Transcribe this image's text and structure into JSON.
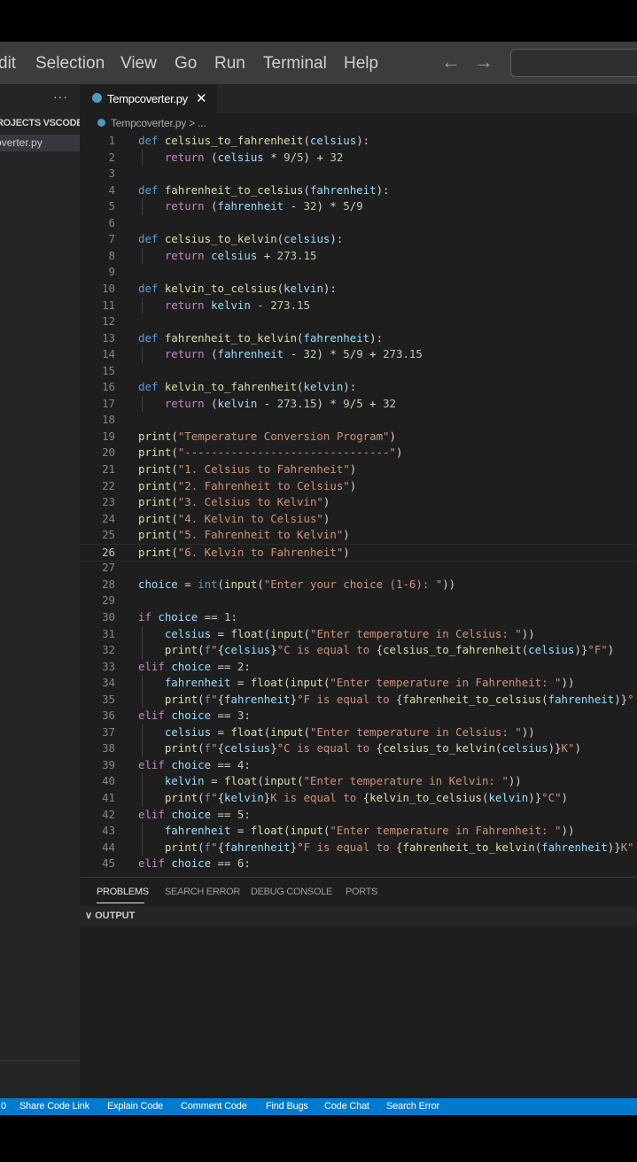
{
  "menubar": {
    "items": [
      "dit",
      "Selection",
      "View",
      "Go",
      "Run",
      "Terminal",
      "Help"
    ],
    "back_arrow": "←",
    "forward_arrow": "→"
  },
  "sidebar": {
    "more": "···",
    "section_title": "ROJECTS VSCODE",
    "file_name": "overter.py"
  },
  "editor": {
    "tab_label": "Tempcoverter.py",
    "tab_close": "✕",
    "breadcrumb": "Tempcoverter.py > ...",
    "current_line": 26,
    "lines": [
      [
        [
          "kw",
          "def "
        ],
        [
          "fn",
          "celsius_to_fahrenheit"
        ],
        [
          "pl",
          "("
        ],
        [
          "var",
          "celsius"
        ],
        [
          "pl",
          "):"
        ]
      ],
      [
        [
          "pl",
          "    "
        ],
        [
          "ctl",
          "return "
        ],
        [
          "pl",
          "("
        ],
        [
          "var",
          "celsius"
        ],
        [
          "pl",
          " * "
        ],
        [
          "num",
          "9"
        ],
        [
          "pl",
          "/"
        ],
        [
          "num",
          "5"
        ],
        [
          "pl",
          ") + "
        ],
        [
          "num",
          "32"
        ]
      ],
      [],
      [
        [
          "kw",
          "def "
        ],
        [
          "fn",
          "fahrenheit_to_celsius"
        ],
        [
          "pl",
          "("
        ],
        [
          "var",
          "fahrenheit"
        ],
        [
          "pl",
          "):"
        ]
      ],
      [
        [
          "pl",
          "    "
        ],
        [
          "ctl",
          "return "
        ],
        [
          "pl",
          "("
        ],
        [
          "var",
          "fahrenheit"
        ],
        [
          "pl",
          " - "
        ],
        [
          "num",
          "32"
        ],
        [
          "pl",
          ") * "
        ],
        [
          "num",
          "5"
        ],
        [
          "pl",
          "/"
        ],
        [
          "num",
          "9"
        ]
      ],
      [],
      [
        [
          "kw",
          "def "
        ],
        [
          "fn",
          "celsius_to_kelvin"
        ],
        [
          "pl",
          "("
        ],
        [
          "var",
          "celsius"
        ],
        [
          "pl",
          "):"
        ]
      ],
      [
        [
          "pl",
          "    "
        ],
        [
          "ctl",
          "return "
        ],
        [
          "var",
          "celsius"
        ],
        [
          "pl",
          " + "
        ],
        [
          "num",
          "273.15"
        ]
      ],
      [],
      [
        [
          "kw",
          "def "
        ],
        [
          "fn",
          "kelvin_to_celsius"
        ],
        [
          "pl",
          "("
        ],
        [
          "var",
          "kelvin"
        ],
        [
          "pl",
          "):"
        ]
      ],
      [
        [
          "pl",
          "    "
        ],
        [
          "ctl",
          "return "
        ],
        [
          "var",
          "kelvin"
        ],
        [
          "pl",
          " - "
        ],
        [
          "num",
          "273.15"
        ]
      ],
      [],
      [
        [
          "kw",
          "def "
        ],
        [
          "fn",
          "fahrenheit_to_kelvin"
        ],
        [
          "pl",
          "("
        ],
        [
          "var",
          "fahrenheit"
        ],
        [
          "pl",
          "):"
        ]
      ],
      [
        [
          "pl",
          "    "
        ],
        [
          "ctl",
          "return "
        ],
        [
          "pl",
          "("
        ],
        [
          "var",
          "fahrenheit"
        ],
        [
          "pl",
          " - "
        ],
        [
          "num",
          "32"
        ],
        [
          "pl",
          ") * "
        ],
        [
          "num",
          "5"
        ],
        [
          "pl",
          "/"
        ],
        [
          "num",
          "9"
        ],
        [
          "pl",
          " + "
        ],
        [
          "num",
          "273.15"
        ]
      ],
      [],
      [
        [
          "kw",
          "def "
        ],
        [
          "fn",
          "kelvin_to_fahrenheit"
        ],
        [
          "pl",
          "("
        ],
        [
          "var",
          "kelvin"
        ],
        [
          "pl",
          "):"
        ]
      ],
      [
        [
          "pl",
          "    "
        ],
        [
          "ctl",
          "return "
        ],
        [
          "pl",
          "("
        ],
        [
          "var",
          "kelvin"
        ],
        [
          "pl",
          " - "
        ],
        [
          "num",
          "273.15"
        ],
        [
          "pl",
          ") * "
        ],
        [
          "num",
          "9"
        ],
        [
          "pl",
          "/"
        ],
        [
          "num",
          "5"
        ],
        [
          "pl",
          " + "
        ],
        [
          "num",
          "32"
        ]
      ],
      [],
      [
        [
          "fn",
          "print"
        ],
        [
          "pl",
          "("
        ],
        [
          "str",
          "\"Temperature Conversion Program\""
        ],
        [
          "pl",
          ")"
        ]
      ],
      [
        [
          "fn",
          "print"
        ],
        [
          "pl",
          "("
        ],
        [
          "str",
          "\"-------------------------------\""
        ],
        [
          "pl",
          ")"
        ]
      ],
      [
        [
          "fn",
          "print"
        ],
        [
          "pl",
          "("
        ],
        [
          "str",
          "\"1. Celsius to Fahrenheit\""
        ],
        [
          "pl",
          ")"
        ]
      ],
      [
        [
          "fn",
          "print"
        ],
        [
          "pl",
          "("
        ],
        [
          "str",
          "\"2. Fahrenheit to Celsius\""
        ],
        [
          "pl",
          ")"
        ]
      ],
      [
        [
          "fn",
          "print"
        ],
        [
          "pl",
          "("
        ],
        [
          "str",
          "\"3. Celsius to Kelvin\""
        ],
        [
          "pl",
          ")"
        ]
      ],
      [
        [
          "fn",
          "print"
        ],
        [
          "pl",
          "("
        ],
        [
          "str",
          "\"4. Kelvin to Celsius\""
        ],
        [
          "pl",
          ")"
        ]
      ],
      [
        [
          "fn",
          "print"
        ],
        [
          "pl",
          "("
        ],
        [
          "str",
          "\"5. Fahrenheit to Kelvin\""
        ],
        [
          "pl",
          ")"
        ]
      ],
      [
        [
          "fn",
          "print"
        ],
        [
          "pl",
          "("
        ],
        [
          "str",
          "\"6. Kelvin to Fahrenheit\""
        ],
        [
          "pl",
          ")"
        ]
      ],
      [],
      [
        [
          "var",
          "choice"
        ],
        [
          "pl",
          " = "
        ],
        [
          "kw",
          "int"
        ],
        [
          "pl",
          "("
        ],
        [
          "fn",
          "input"
        ],
        [
          "pl",
          "("
        ],
        [
          "str",
          "\"Enter your choice (1-6): \""
        ],
        [
          "pl",
          "))"
        ]
      ],
      [],
      [
        [
          "ctl",
          "if "
        ],
        [
          "var",
          "choice"
        ],
        [
          "pl",
          " == "
        ],
        [
          "num",
          "1"
        ],
        [
          "pl",
          ":"
        ]
      ],
      [
        [
          "pl",
          "    "
        ],
        [
          "var",
          "celsius"
        ],
        [
          "pl",
          " = "
        ],
        [
          "fn",
          "float"
        ],
        [
          "pl",
          "("
        ],
        [
          "fn",
          "input"
        ],
        [
          "pl",
          "("
        ],
        [
          "str",
          "\"Enter temperature in Celsius: \""
        ],
        [
          "pl",
          "))"
        ]
      ],
      [
        [
          "pl",
          "    "
        ],
        [
          "fn",
          "print"
        ],
        [
          "pl",
          "("
        ],
        [
          "kw",
          "f"
        ],
        [
          "str",
          "\""
        ],
        [
          "pl",
          "{"
        ],
        [
          "var",
          "celsius"
        ],
        [
          "pl",
          "}"
        ],
        [
          "str",
          "°C is equal to "
        ],
        [
          "pl",
          "{"
        ],
        [
          "fn",
          "celsius_to_fahrenheit"
        ],
        [
          "pl",
          "("
        ],
        [
          "var",
          "celsius"
        ],
        [
          "pl",
          ")}"
        ],
        [
          "str",
          "°F\""
        ],
        [
          "pl",
          ")"
        ]
      ],
      [
        [
          "ctl",
          "elif "
        ],
        [
          "var",
          "choice"
        ],
        [
          "pl",
          " == "
        ],
        [
          "num",
          "2"
        ],
        [
          "pl",
          ":"
        ]
      ],
      [
        [
          "pl",
          "    "
        ],
        [
          "var",
          "fahrenheit"
        ],
        [
          "pl",
          " = "
        ],
        [
          "fn",
          "float"
        ],
        [
          "pl",
          "("
        ],
        [
          "fn",
          "input"
        ],
        [
          "pl",
          "("
        ],
        [
          "str",
          "\"Enter temperature in Fahrenheit: \""
        ],
        [
          "pl",
          "))"
        ]
      ],
      [
        [
          "pl",
          "    "
        ],
        [
          "fn",
          "print"
        ],
        [
          "pl",
          "("
        ],
        [
          "kw",
          "f"
        ],
        [
          "str",
          "\""
        ],
        [
          "pl",
          "{"
        ],
        [
          "var",
          "fahrenheit"
        ],
        [
          "pl",
          "}"
        ],
        [
          "str",
          "°F is equal to "
        ],
        [
          "pl",
          "{"
        ],
        [
          "fn",
          "fahrenheit_to_celsius"
        ],
        [
          "pl",
          "("
        ],
        [
          "var",
          "fahrenheit"
        ],
        [
          "pl",
          ")}"
        ],
        [
          "str",
          "°"
        ]
      ],
      [
        [
          "ctl",
          "elif "
        ],
        [
          "var",
          "choice"
        ],
        [
          "pl",
          " == "
        ],
        [
          "num",
          "3"
        ],
        [
          "pl",
          ":"
        ]
      ],
      [
        [
          "pl",
          "    "
        ],
        [
          "var",
          "celsius"
        ],
        [
          "pl",
          " = "
        ],
        [
          "fn",
          "float"
        ],
        [
          "pl",
          "("
        ],
        [
          "fn",
          "input"
        ],
        [
          "pl",
          "("
        ],
        [
          "str",
          "\"Enter temperature in Celsius: \""
        ],
        [
          "pl",
          "))"
        ]
      ],
      [
        [
          "pl",
          "    "
        ],
        [
          "fn",
          "print"
        ],
        [
          "pl",
          "("
        ],
        [
          "kw",
          "f"
        ],
        [
          "str",
          "\""
        ],
        [
          "pl",
          "{"
        ],
        [
          "var",
          "celsius"
        ],
        [
          "pl",
          "}"
        ],
        [
          "str",
          "°C is equal to "
        ],
        [
          "pl",
          "{"
        ],
        [
          "fn",
          "celsius_to_kelvin"
        ],
        [
          "pl",
          "("
        ],
        [
          "var",
          "celsius"
        ],
        [
          "pl",
          ")}"
        ],
        [
          "str",
          "K\""
        ],
        [
          "pl",
          ")"
        ]
      ],
      [
        [
          "ctl",
          "elif "
        ],
        [
          "var",
          "choice"
        ],
        [
          "pl",
          " == "
        ],
        [
          "num",
          "4"
        ],
        [
          "pl",
          ":"
        ]
      ],
      [
        [
          "pl",
          "    "
        ],
        [
          "var",
          "kelvin"
        ],
        [
          "pl",
          " = "
        ],
        [
          "fn",
          "float"
        ],
        [
          "pl",
          "("
        ],
        [
          "fn",
          "input"
        ],
        [
          "pl",
          "("
        ],
        [
          "str",
          "\"Enter temperature in Kelvin: \""
        ],
        [
          "pl",
          "))"
        ]
      ],
      [
        [
          "pl",
          "    "
        ],
        [
          "fn",
          "print"
        ],
        [
          "pl",
          "("
        ],
        [
          "kw",
          "f"
        ],
        [
          "str",
          "\""
        ],
        [
          "pl",
          "{"
        ],
        [
          "var",
          "kelvin"
        ],
        [
          "pl",
          "}"
        ],
        [
          "str",
          "K is equal to "
        ],
        [
          "pl",
          "{"
        ],
        [
          "fn",
          "kelvin_to_celsius"
        ],
        [
          "pl",
          "("
        ],
        [
          "var",
          "kelvin"
        ],
        [
          "pl",
          ")}"
        ],
        [
          "str",
          "°C\""
        ],
        [
          "pl",
          ")"
        ]
      ],
      [
        [
          "ctl",
          "elif "
        ],
        [
          "var",
          "choice"
        ],
        [
          "pl",
          " == "
        ],
        [
          "num",
          "5"
        ],
        [
          "pl",
          ":"
        ]
      ],
      [
        [
          "pl",
          "    "
        ],
        [
          "var",
          "fahrenheit"
        ],
        [
          "pl",
          " = "
        ],
        [
          "fn",
          "float"
        ],
        [
          "pl",
          "("
        ],
        [
          "fn",
          "input"
        ],
        [
          "pl",
          "("
        ],
        [
          "str",
          "\"Enter temperature in Fahrenheit: \""
        ],
        [
          "pl",
          "))"
        ]
      ],
      [
        [
          "pl",
          "    "
        ],
        [
          "fn",
          "print"
        ],
        [
          "pl",
          "("
        ],
        [
          "kw",
          "f"
        ],
        [
          "str",
          "\""
        ],
        [
          "pl",
          "{"
        ],
        [
          "var",
          "fahrenheit"
        ],
        [
          "pl",
          "}"
        ],
        [
          "str",
          "°F is equal to "
        ],
        [
          "pl",
          "{"
        ],
        [
          "fn",
          "fahrenheit_to_kelvin"
        ],
        [
          "pl",
          "("
        ],
        [
          "var",
          "fahrenheit"
        ],
        [
          "pl",
          ")}"
        ],
        [
          "str",
          "K\""
        ]
      ],
      [
        [
          "ctl",
          "elif "
        ],
        [
          "var",
          "choice"
        ],
        [
          "pl",
          " == "
        ],
        [
          "num",
          "6"
        ],
        [
          "pl",
          ":"
        ]
      ]
    ]
  },
  "panel": {
    "tabs": [
      "PROBLEMS",
      "SEARCH ERROR",
      "DEBUG CONSOLE",
      "PORTS"
    ],
    "output_header": "∨ OUTPUT"
  },
  "statusbar": {
    "items": [
      "0",
      "Share Code Link",
      "Explain Code",
      "Comment Code",
      "Find Bugs",
      "Code Chat",
      "Search Error"
    ]
  },
  "colors": {
    "accent": "#007acc",
    "editor_bg": "#1e1e1e",
    "python_icon": "#519aba"
  }
}
